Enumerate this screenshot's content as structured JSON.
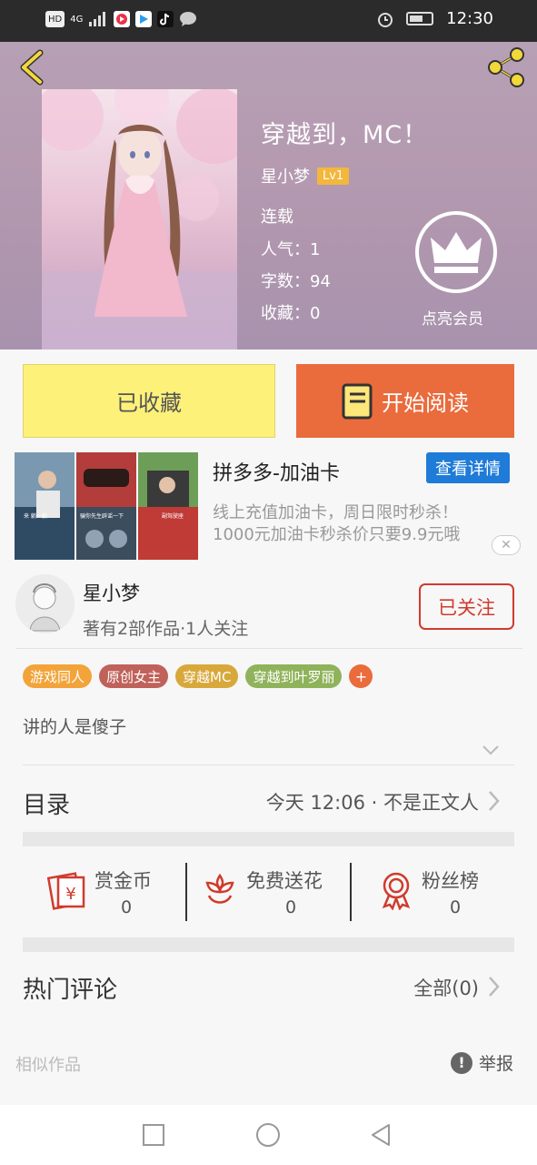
{
  "status_bar": {
    "network": "HD",
    "signal": "4G",
    "time": "12:30"
  },
  "book": {
    "title": "穿越到，MC！",
    "author": "星小梦",
    "level": "Lv1",
    "status": "连载",
    "popularity": "人气：1",
    "word_count": "字数：94",
    "favorites": "收藏：0"
  },
  "vip": {
    "label": "点亮会员"
  },
  "actions": {
    "favorited_label": "已收藏",
    "read_label": "开始阅读"
  },
  "ad": {
    "title": "拼多多-加油卡",
    "button": "查看详情",
    "description_line1": "线上充值加油卡，周日限时秒杀！",
    "description_line2": "1000元加油卡秒杀价只要9.9元哦",
    "img_captions": [
      "来 躺一躺",
      "骗你先生辟谣一下",
      "副驾驶座"
    ]
  },
  "author_card": {
    "name": "星小梦",
    "meta": "著有2部作品·1人关注",
    "follow_label": "已关注"
  },
  "tags": [
    {
      "label": "游戏同人",
      "color": "#f2a43a"
    },
    {
      "label": "原创女主",
      "color": "#c0625a"
    },
    {
      "label": "穿越MC",
      "color": "#d8a83a"
    },
    {
      "label": "穿越到叶罗丽",
      "color": "#8fb35a"
    }
  ],
  "tag_add": "+",
  "summary": "讲的人是傻子",
  "catalog": {
    "label": "目录",
    "latest": "今天 12:06 · 不是正文人"
  },
  "stats": [
    {
      "label": "赏金币",
      "value": "0",
      "icon": "envelope-yen-icon"
    },
    {
      "label": "免费送花",
      "value": "0",
      "icon": "flower-icon"
    },
    {
      "label": "粉丝榜",
      "value": "0",
      "icon": "medal-icon"
    }
  ],
  "comments": {
    "label": "热门评论",
    "all": "全部(0)"
  },
  "similar_label": "相似作品",
  "report_label": "举报",
  "colors": {
    "accent_orange": "#ea6b3c",
    "yellow_button": "#fdf17a",
    "follow_red": "#d03b2d",
    "ad_blue": "#1f7bd8"
  }
}
